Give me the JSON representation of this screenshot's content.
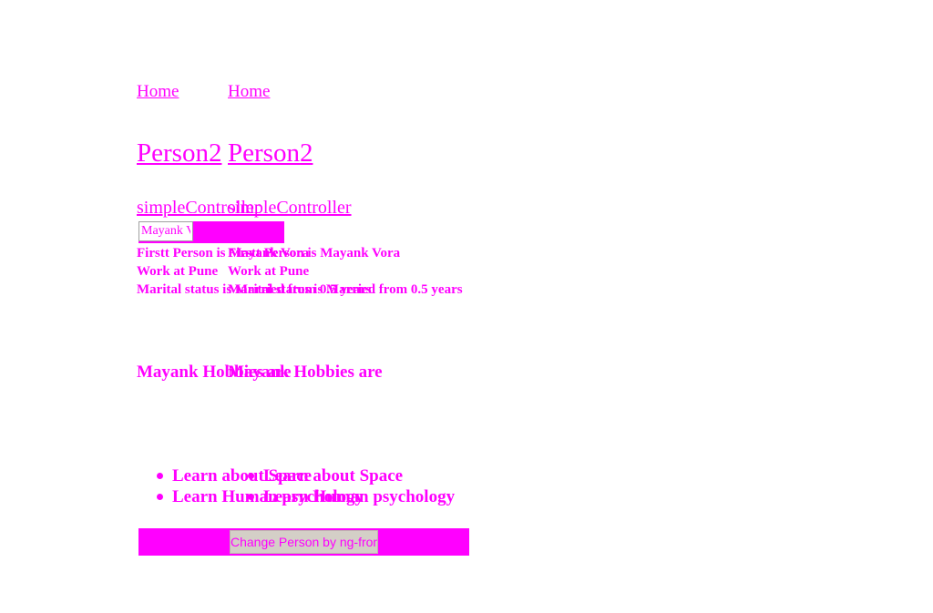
{
  "nav": {
    "home_label": "Home"
  },
  "page": {
    "title": "Person2",
    "controller_label": "simpleController"
  },
  "form": {
    "name_value": "Mayank Vora"
  },
  "info": {
    "line1": "Firstt Person is Mayank Vora",
    "line2": "Work at Pune",
    "line3": "Marital status is Married from 0.5 years"
  },
  "hobbies": {
    "heading": "Mayank Hobbies are",
    "items": [
      "Learn about Space",
      "Learn Human psychology"
    ]
  },
  "actions": {
    "change_label": "Change Person by ng-from"
  },
  "colors": {
    "text": "#ff00ff",
    "button_bg": "#d4cfc7"
  }
}
